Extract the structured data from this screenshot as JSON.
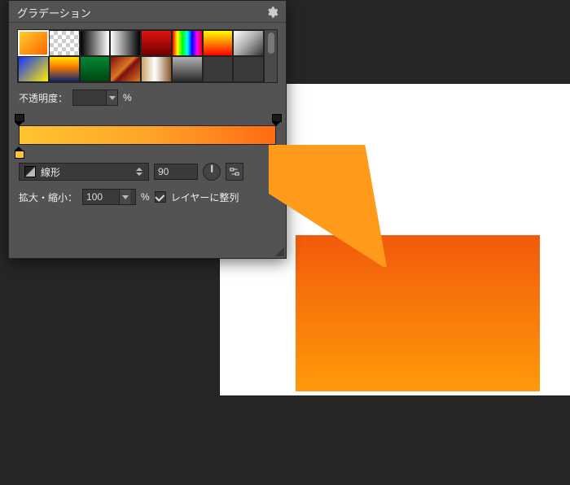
{
  "panel": {
    "title": "グラデーション",
    "menu_icon": "gear-icon"
  },
  "swatches": [
    {
      "css": "linear-gradient(135deg,#ffcf2d 0%,#ff6200 100%)",
      "selected": true
    },
    {
      "css": "repeating-conic-gradient(#ccc 0 25%,#fff 0 50%) 0/10px 10px",
      "selected": false
    },
    {
      "css": "linear-gradient(90deg,#000,#fff)",
      "selected": false
    },
    {
      "css": "linear-gradient(90deg,#fff,#000)",
      "selected": false
    },
    {
      "css": "linear-gradient(180deg,#e31212 0%,#6d0000 100%)",
      "selected": false
    },
    {
      "css": "linear-gradient(90deg,#f00,#ff0,#0f0,#0ff,#00f,#f0f,#f00)",
      "selected": false
    },
    {
      "css": "linear-gradient(180deg,#ff0 0%,#f00 100%)",
      "selected": false
    },
    {
      "css": "linear-gradient(135deg,#fff 0%,#aaa 50%,#333 100%)",
      "selected": false
    },
    {
      "css": "linear-gradient(135deg,#1133ff 0%,#ffee00 100%)",
      "selected": false
    },
    {
      "css": "linear-gradient(180deg,#ffe600 0%,#ff7a00 40%,#06246e 100%)",
      "selected": false
    },
    {
      "css": "linear-gradient(180deg,#083 0%,#041 100%)",
      "selected": false
    },
    {
      "css": "linear-gradient(135deg,#7a0f0f 0%,#d72 45%,#7a0f0f 55%,#d72 100%)",
      "selected": false
    },
    {
      "css": "linear-gradient(90deg,#caa46a 0%,#fff 45%,#8b5a2b 100%)",
      "selected": false
    },
    {
      "css": "linear-gradient(180deg,#b0b0b0 0%,#2a2a2a 100%)",
      "selected": false
    },
    {
      "css": "#3a3a3a",
      "selected": false
    },
    {
      "css": "#3a3a3a",
      "selected": false
    }
  ],
  "opacity": {
    "label": "不透明度：",
    "value": "",
    "unit": "%"
  },
  "gradient": {
    "opacity_stops": [
      0,
      100
    ],
    "color_stops": [
      {
        "pos": 0,
        "color": "#ffc431"
      },
      {
        "pos": 100,
        "color": "#ff6b14"
      }
    ]
  },
  "type": {
    "label": "線形",
    "angle": "90"
  },
  "scale": {
    "label": "拡大・縮小：",
    "value": "100",
    "unit": "%"
  },
  "align": {
    "label": "レイヤーに整列",
    "checked": true
  },
  "arrow": {
    "color": "#ff9a1a"
  }
}
